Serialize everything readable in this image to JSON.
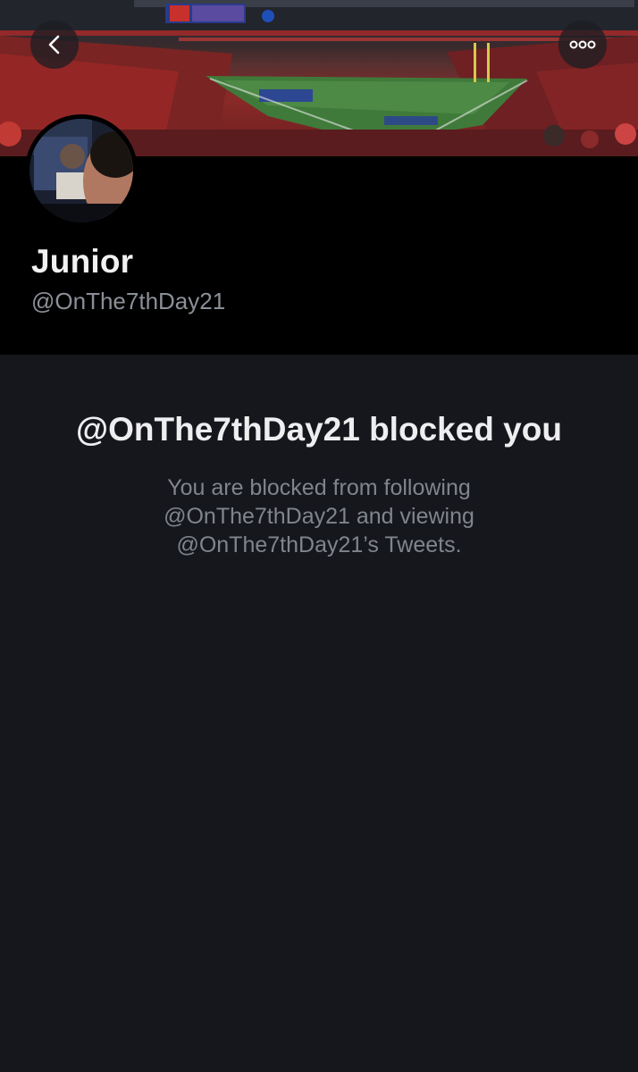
{
  "profile": {
    "display_name": "Junior",
    "handle": "@OnThe7thDay21"
  },
  "blocked_notice": {
    "title": "@OnThe7thDay21 blocked you",
    "message": "You are blocked from following @OnThe7thDay21 and viewing @OnThe7thDay21’s Tweets."
  },
  "icons": {
    "back": "chevron-left-icon",
    "more": "more-dots-icon"
  },
  "colors": {
    "background": "#15171c",
    "header_background": "#000000",
    "name_text": "#f1f1f2",
    "secondary_text": "#8b8f97"
  }
}
